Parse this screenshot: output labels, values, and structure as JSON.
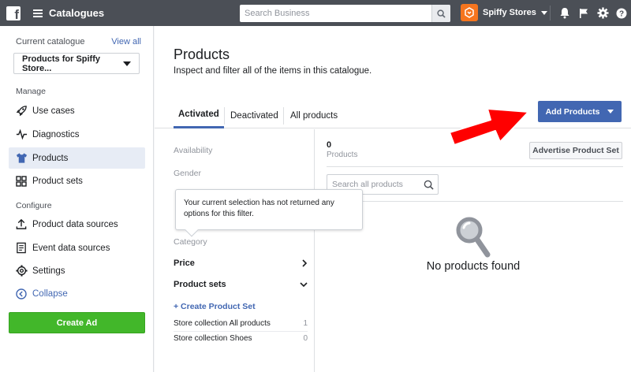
{
  "topbar": {
    "title": "Catalogues",
    "search_placeholder": "Search Business",
    "business_name": "Spiffy Stores",
    "colors": {
      "bar": "#4b4f56",
      "avatar": "#f5751f"
    },
    "icons": [
      "facebook-logo",
      "menu-icon",
      "search-icon",
      "bell-icon",
      "flag-icon",
      "gear-icon",
      "help-icon"
    ]
  },
  "sidebar": {
    "current_catalogue_label": "Current catalogue",
    "view_all": "View all",
    "catalogue_select": "Products for Spiffy Store...",
    "manage_label": "Manage",
    "manage_items": [
      {
        "label": "Use cases",
        "icon": "rocket-icon"
      },
      {
        "label": "Diagnostics",
        "icon": "pulse-icon"
      },
      {
        "label": "Products",
        "icon": "shirt-icon",
        "active": true
      },
      {
        "label": "Product sets",
        "icon": "grid-icon"
      }
    ],
    "configure_label": "Configure",
    "configure_items": [
      {
        "label": "Product data sources",
        "icon": "upload-icon"
      },
      {
        "label": "Event data sources",
        "icon": "document-icon"
      },
      {
        "label": "Settings",
        "icon": "gear-icon"
      }
    ],
    "collapse": "Collapse",
    "create_ad": "Create Ad",
    "colors": {
      "active_bg": "#e7ecf5",
      "create_ad": "#42b72a",
      "link": "#4267b2"
    }
  },
  "main": {
    "title": "Products",
    "subtitle": "Inspect and filter all of the items in this catalogue.",
    "tabs": [
      "Activated",
      "Deactivated",
      "All products"
    ],
    "active_tab": "Activated",
    "add_products": "Add Products",
    "filters": {
      "availability": "Availability",
      "gender": "Gender",
      "category": "Category",
      "price": "Price",
      "product_sets": "Product sets",
      "create_product_set": "+ Create Product Set",
      "sets": [
        {
          "name": "Store collection All products",
          "count": "1"
        },
        {
          "name": "Store collection Shoes",
          "count": "0"
        }
      ]
    },
    "tooltip": "Your current selection has not returned any options for this filter.",
    "count": "0",
    "count_label": "Products",
    "advertise": "Advertise Product Set",
    "search_placeholder": "Search all products",
    "empty_message": "No products found",
    "colors": {
      "primary": "#4267b2",
      "annotation_arrow": "#ff0000"
    }
  }
}
